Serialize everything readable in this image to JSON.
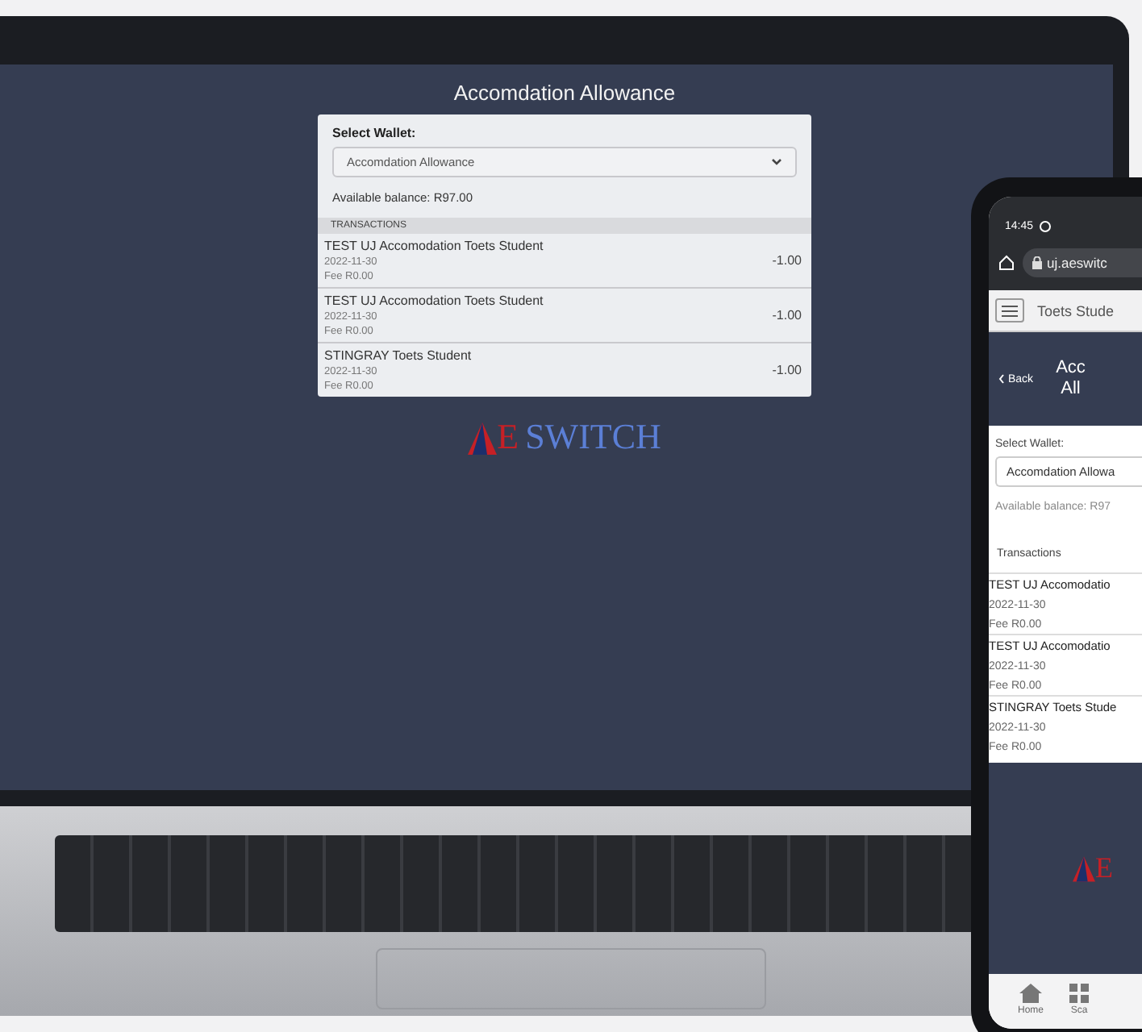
{
  "laptop": {
    "page_title": "Accomdation Allowance",
    "wallet_label": "Select Wallet:",
    "wallet_value": "Accomdation Allowance",
    "balance": "Available balance: R97.00",
    "transactions_heading": "TRANSACTIONS",
    "transactions": [
      {
        "name": "TEST UJ Accomodation Toets Student",
        "date": "2022-11-30",
        "fee": "Fee R0.00",
        "amount": "-1.00"
      },
      {
        "name": "TEST UJ Accomodation Toets Student",
        "date": "2022-11-30",
        "fee": "Fee R0.00",
        "amount": "-1.00"
      },
      {
        "name": "STINGRAY Toets Student",
        "date": "2022-11-30",
        "fee": "Fee R0.00",
        "amount": "-1.00"
      }
    ],
    "logo": {
      "letter": "E",
      "word": "SWITCH"
    }
  },
  "phone": {
    "time": "14:45",
    "url": "uj.aeswitc",
    "user": "Toets Stude",
    "back": "Back",
    "title_lines": [
      "Acc",
      "All"
    ],
    "wallet_label": "Select Wallet:",
    "wallet_value": "Accomdation Allowa",
    "balance": "Available balance: R97",
    "transactions_heading": "Transactions",
    "transactions": [
      {
        "name": "TEST UJ Accomodatio",
        "date": "2022-11-30",
        "fee": "Fee R0.00"
      },
      {
        "name": "TEST UJ Accomodatio",
        "date": "2022-11-30",
        "fee": "Fee R0.00"
      },
      {
        "name": "STINGRAY Toets Stude",
        "date": "2022-11-30",
        "fee": "Fee R0.00"
      }
    ],
    "logo_letter": "E",
    "nav": [
      {
        "label": "Home",
        "kind": "home"
      },
      {
        "label": "Sca",
        "kind": "scan"
      }
    ]
  }
}
